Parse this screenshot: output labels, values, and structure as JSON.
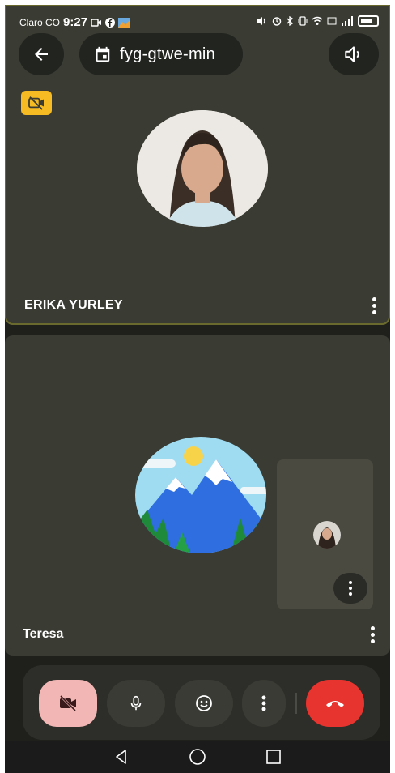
{
  "status_bar": {
    "carrier": "Claro CO",
    "time": "9:27"
  },
  "header": {
    "meeting_code": "fyg-gtwe-min"
  },
  "participants": [
    {
      "name": "ERIKA YURLEY"
    },
    {
      "name": "Teresa"
    }
  ],
  "icons": {
    "back": "arrow-left-icon",
    "calendar": "calendar-icon",
    "speaker": "speaker-icon",
    "camera_off": "camera-off-icon",
    "more": "more-vert-icon",
    "mic": "mic-icon",
    "emoji": "emoji-icon",
    "hangup": "call-end-icon",
    "nav_back": "nav-back-icon",
    "nav_home": "nav-home-icon",
    "nav_recents": "nav-recents-icon"
  },
  "colors": {
    "tile_background": "#3a3b32",
    "active_speaker_border": "#6b6a2e",
    "camera_off_badge": "#f6bb23",
    "camera_button": "#f2b7b5",
    "hangup_button": "#e8342f"
  }
}
